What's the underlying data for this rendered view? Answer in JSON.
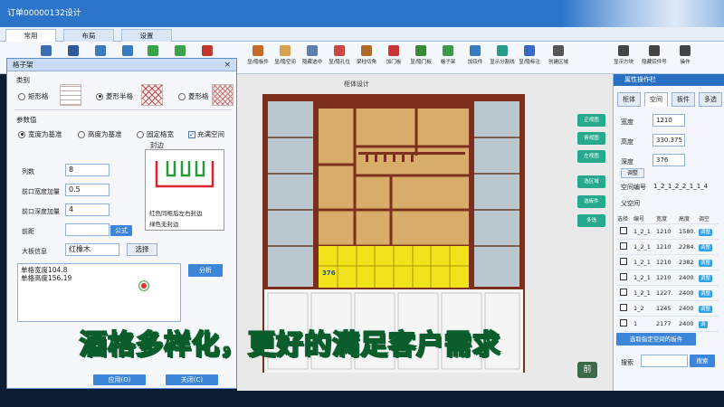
{
  "window": {
    "title": "订单00000132设计"
  },
  "tabs": [
    {
      "label": "常用"
    },
    {
      "label": "布局"
    },
    {
      "label": "设置"
    }
  ],
  "ribbon": {
    "items": [
      {
        "label": "显/隐板件",
        "icon": "panel-icon",
        "color": "#c96a2a"
      },
      {
        "label": "显/隐空间",
        "icon": "box-icon",
        "color": "#d9a050"
      },
      {
        "label": "隐藏选中",
        "icon": "hide-icon",
        "color": "#5c7fb0"
      },
      {
        "label": "显/隐孔位",
        "icon": "hole-icon",
        "color": "#c44"
      },
      {
        "label": "梁柱切角",
        "icon": "cut-icon",
        "color": "#b26a2a"
      },
      {
        "label": "加门板",
        "icon": "door-icon",
        "color": "#c33"
      },
      {
        "label": "显/隐门板",
        "icon": "door-toggle-icon",
        "color": "#3a8a3a"
      },
      {
        "label": "格子架",
        "icon": "grid-icon",
        "color": "#3a9a4a"
      },
      {
        "label": "加铰件",
        "icon": "hinge-icon",
        "color": "#3a7ac0"
      },
      {
        "label": "显示分割线",
        "icon": "split-icon",
        "color": "#2a9a8a"
      },
      {
        "label": "显/隐标注",
        "icon": "dimension-icon",
        "color": "#3a6ac0"
      },
      {
        "label": "创建区域",
        "icon": "area-icon",
        "color": "#555"
      },
      {
        "label": "显示方块",
        "icon": "block-icon",
        "color": "#444"
      },
      {
        "label": "隐藏铰件号",
        "icon": "tag-icon",
        "color": "#444"
      },
      {
        "label": "操作",
        "icon": "operate-icon",
        "color": "#444"
      }
    ]
  },
  "dialog": {
    "title": "格子架",
    "category_label": "类别",
    "category_options": [
      {
        "label": "矩形格"
      },
      {
        "label": "菱形半格"
      },
      {
        "label": "菱形格"
      }
    ],
    "params_label": "参数值",
    "base_options": [
      {
        "label": "宽度为基准"
      },
      {
        "label": "高度为基准"
      },
      {
        "label": "固定格宽"
      }
    ],
    "fill_space": "充满空间",
    "edge_title": "封边",
    "edge_note1": "红色同柜后左右封边",
    "edge_note2": "绿色无封边",
    "fields": [
      {
        "label": "列数",
        "value": "8"
      },
      {
        "label": "前口宽度加量",
        "value": "0.5"
      },
      {
        "label": "前口深度加量",
        "value": "4"
      },
      {
        "label": "前距",
        "value": ""
      },
      {
        "label": "大板信息",
        "value": "红橡木"
      }
    ],
    "formula_button": "公式",
    "select_button": "选择",
    "output_lines": [
      "单格宽度104.8",
      "单格高度156.19"
    ],
    "analyze_button": "分析",
    "apply_button": "应用(O)",
    "close_button": "关闭(C)"
  },
  "canvas": {
    "title": "柜体设计",
    "dimension_label": "376",
    "view_buttons": [
      "正视图",
      "俯视图",
      "左视图",
      "选区域",
      "选板件",
      "多选"
    ],
    "watermark": "前"
  },
  "right_panel": {
    "title": "属性操作栏",
    "tabs": [
      "柜体",
      "空间",
      "板件",
      "多选"
    ],
    "width_label": "宽度",
    "width_value": "1210",
    "height_label": "高度",
    "height_value": "330.375",
    "depth_label": "深度",
    "depth_value": "376",
    "adjust_button": "调整",
    "space_no_label": "空间编号",
    "space_no_value": "1_2_1_2_2_1_1_4",
    "parent_label": "父空间",
    "grid_headers": [
      "选择",
      "编号",
      "宽度",
      "高度",
      "调空"
    ],
    "grid_rows": [
      {
        "no": "1_2_1",
        "w": "1210",
        "h": "1580.",
        "btn": "调整"
      },
      {
        "no": "1_2_1",
        "w": "1210",
        "h": "2284.",
        "btn": "调整"
      },
      {
        "no": "1_2_1",
        "w": "1210",
        "h": "2382",
        "btn": "调整"
      },
      {
        "no": "1_2_1",
        "w": "1210",
        "h": "2400",
        "btn": "调整"
      },
      {
        "no": "1_2_1",
        "w": "1227.",
        "h": "2400",
        "btn": "调整"
      },
      {
        "no": "1_2",
        "w": "1245",
        "h": "2400",
        "btn": "调整"
      },
      {
        "no": "1",
        "w": "2177",
        "h": "2400",
        "btn": "调"
      }
    ],
    "select_parent_button": "选取指定空间的板件",
    "search_label": "搜索",
    "search_button": "搜索"
  },
  "subtitle": "酒格多样化，更好的满足客户需求",
  "colors": {
    "titlebar": "#2b74c9",
    "accent_blue": "#3b86d8",
    "teal": "#26a98c",
    "cabinet_frame": "#8a3a22",
    "wood": "#d8ad6a",
    "grid_yellow": "#f2e21a"
  }
}
